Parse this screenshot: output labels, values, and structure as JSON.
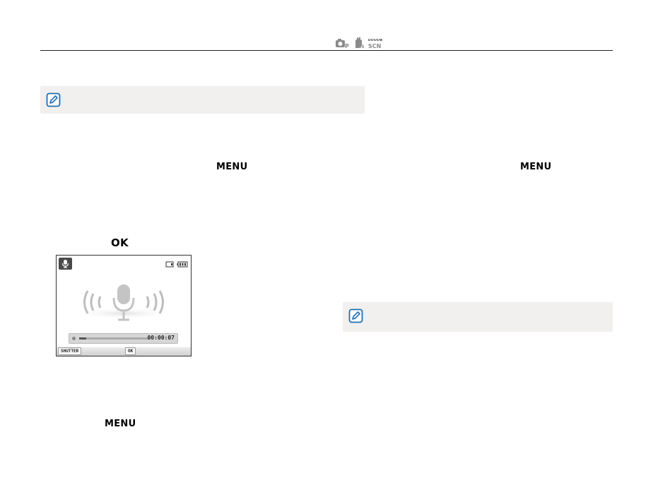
{
  "keys": {
    "menu_1": "MENU",
    "menu_2": "MENU",
    "menu_3": "MENU",
    "ok": "OK"
  },
  "lcd": {
    "record_time": "00:00:07",
    "progress": 0.1,
    "softkey_shutter": "SHUTTER",
    "softkey_ok": "OK"
  },
  "icons": {
    "mode_icons": [
      "camera-op-icon",
      "dual-is-icon",
      "scene-icon"
    ],
    "note_icon": "note-pencil-icon",
    "lcd_icons": [
      "voice-memo-icon",
      "memory-card-icon",
      "battery-icon",
      "microphone-icon",
      "sound-waves-icon"
    ]
  },
  "colors": {
    "note_bg": "#f1f0ee",
    "note_icon_blue": "#1f6fb8",
    "rule": "#222222"
  }
}
